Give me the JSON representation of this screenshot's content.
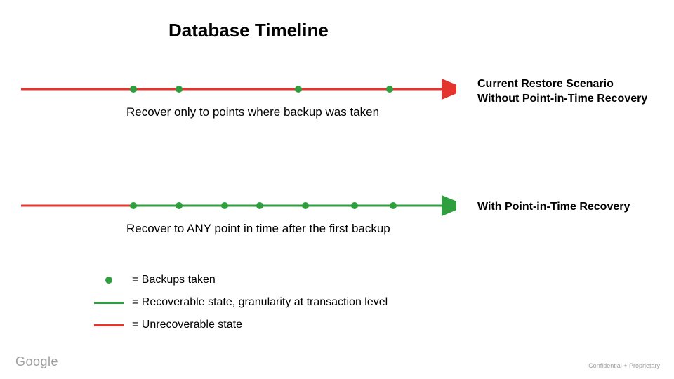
{
  "title": "Database Timeline",
  "timeline1": {
    "caption": "Recover only to points where backup was taken",
    "label_line1": "Current Restore Scenario",
    "label_line2": "Without Point-in-Time Recovery"
  },
  "timeline2": {
    "caption": "Recover to ANY point in time after the first backup",
    "label": "With Point-in-Time Recovery"
  },
  "legend": {
    "backups": "= Backups taken",
    "recoverable": "= Recoverable state, granularity at transaction level",
    "unrecoverable": "= Unrecoverable state"
  },
  "footer": {
    "logo": "Google",
    "note": "Confidential + Proprietary"
  },
  "colors": {
    "green": "#2e9e3f",
    "red": "#e3352d"
  }
}
